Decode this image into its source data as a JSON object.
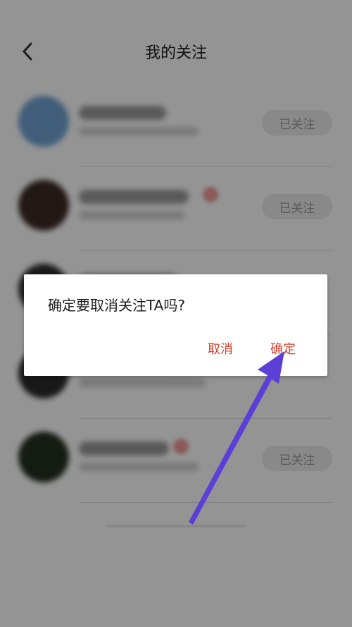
{
  "header": {
    "title": "我的关注"
  },
  "following_list": {
    "items": [
      {
        "follow_label": "已关注"
      },
      {
        "follow_label": "已关注"
      },
      {
        "follow_label": ""
      },
      {
        "follow_label": ""
      },
      {
        "follow_label": "已关注"
      }
    ]
  },
  "dialog": {
    "message": "确定要取消关注TA吗?",
    "cancel_label": "取消",
    "confirm_label": "确定"
  },
  "colors": {
    "accent": "#d0402d",
    "annotation_arrow": "#5b3fd6"
  }
}
